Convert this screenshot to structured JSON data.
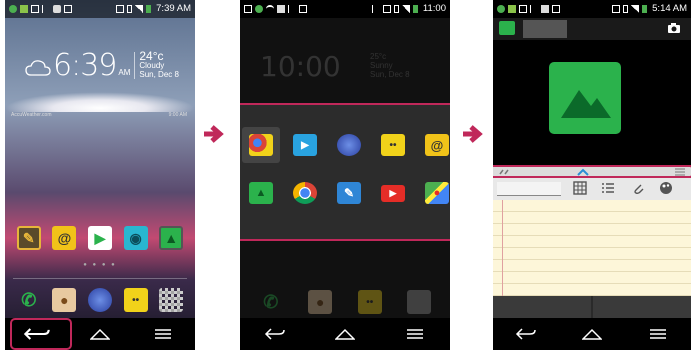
{
  "screens": [
    {
      "status": {
        "time": "7:39 AM"
      },
      "weather": {
        "time": "6:39",
        "ampm": "AM",
        "temp": "24°c",
        "condition": "Cloudy",
        "date": "Sun, Dec 8",
        "provider": "AccuWeather.com",
        "updated": "9:00 AM"
      },
      "apps_row1": [
        {
          "icon": "memo-icon",
          "color": "#e6b53a"
        },
        {
          "icon": "email-icon",
          "color": "#f1c319"
        },
        {
          "icon": "play-store-icon",
          "color": "#ffffff"
        },
        {
          "icon": "camera-icon",
          "color": "#29b6d0"
        },
        {
          "icon": "gallery-icon",
          "color": "#2bb24c"
        }
      ],
      "apps_dock": [
        {
          "icon": "phone-icon",
          "color": "#2bb24c"
        },
        {
          "icon": "contacts-icon",
          "color": "#b46b3a"
        },
        {
          "icon": "internet-icon",
          "color": "#3a5fc8"
        },
        {
          "icon": "messaging-icon",
          "color": "#f1d21a"
        },
        {
          "icon": "apps-icon",
          "color": "#cccccc"
        }
      ]
    },
    {
      "status": {
        "time": "11:00"
      },
      "clock": {
        "time": "10:00",
        "temp": "25°c",
        "condition": "Sunny",
        "date": "Sun, Dec 8"
      },
      "popup_row1": [
        {
          "icon": "chrome-messaging-icon",
          "color": "#f1d21a",
          "selected": true
        },
        {
          "icon": "video-icon",
          "color": "#29a3e0",
          "selected": false
        },
        {
          "icon": "internet-icon",
          "color": "#3a5fc8",
          "selected": false
        },
        {
          "icon": "messaging-icon",
          "color": "#f1d21a",
          "selected": false
        },
        {
          "icon": "email-icon",
          "color": "#f1c319",
          "selected": false
        }
      ],
      "popup_row2": [
        {
          "icon": "gallery-icon",
          "color": "#2bb24c"
        },
        {
          "icon": "chrome-icon",
          "color": "#dd4b39"
        },
        {
          "icon": "memo-icon",
          "color": "#2f86d6"
        },
        {
          "icon": "youtube-icon",
          "color": "#e52d27"
        },
        {
          "icon": "maps-icon",
          "color": "#4caf50"
        }
      ]
    },
    {
      "status": {
        "time": "5:14 AM"
      }
    }
  ],
  "colors": {
    "highlight": "#c0285a",
    "arrow": "#c0285a",
    "gallery_green": "#2bb24c"
  }
}
